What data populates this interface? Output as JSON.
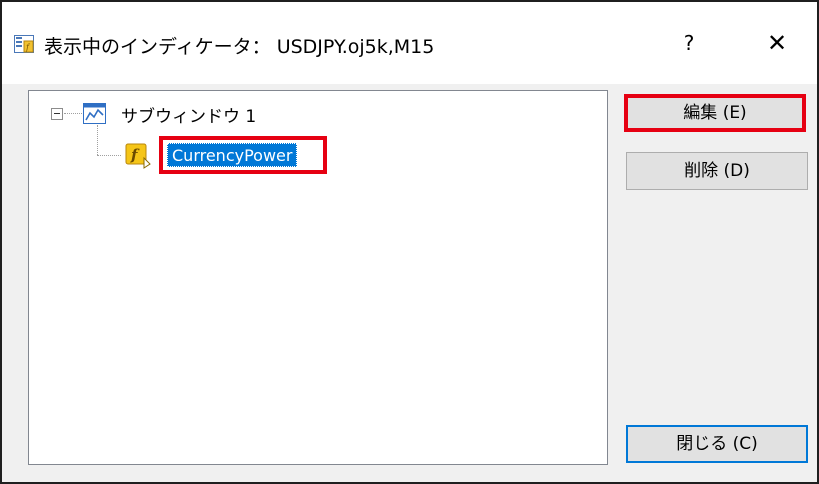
{
  "dialog": {
    "title": "表示中のインディケータ： USDJPY.oj5k,M15",
    "help_label": "?",
    "close_label": "✕"
  },
  "tree": {
    "subwindow_label": "サブウィンドウ 1",
    "indicator_label": "CurrencyPower"
  },
  "buttons": {
    "edit_label": "編集 ",
    "edit_hotkey": "(E)",
    "delete_label": "削除 ",
    "delete_hotkey": "(D)",
    "close_label": "閉じる ",
    "close_hotkey": "(C)"
  },
  "colors": {
    "highlight_red": "#e60012",
    "selection_blue": "#0078d7",
    "dialog_bg": "#f0f0f0"
  }
}
